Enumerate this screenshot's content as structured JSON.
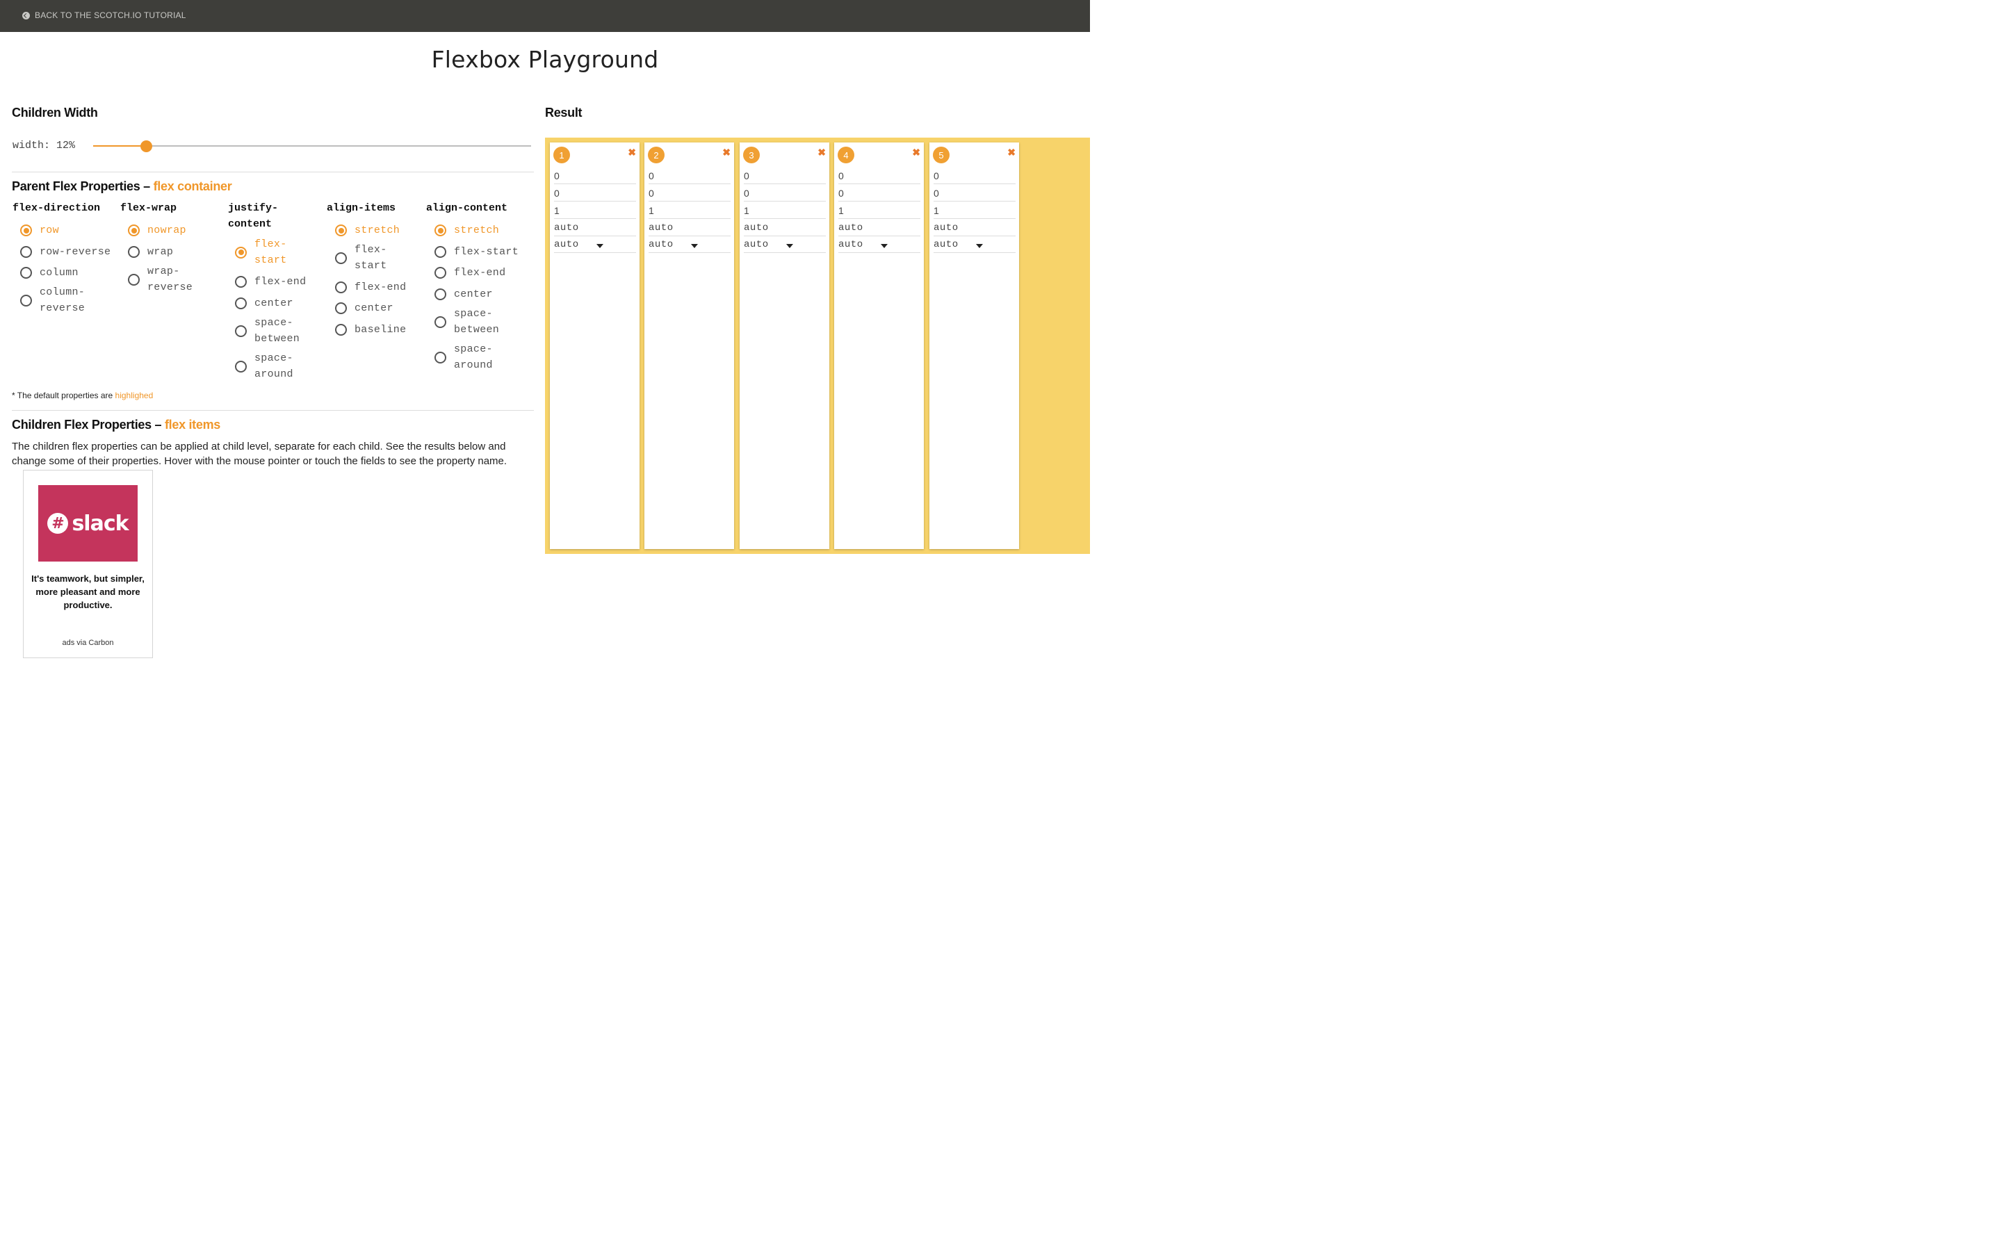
{
  "topbar": {
    "back_label": "BACK TO THE SCOTCH.IO TUTORIAL",
    "icon": "arrow-circle-left-icon"
  },
  "page_title": "Flexbox Playground",
  "children_width": {
    "heading": "Children Width",
    "label": "width: 12%",
    "value_percent": 12
  },
  "parent": {
    "heading": "Parent Flex Properties – ",
    "heading_accent": "flex container",
    "groups": [
      {
        "name": "flex-direction",
        "options": [
          "row",
          "row-reverse",
          "column",
          "column-reverse"
        ],
        "selected": "row"
      },
      {
        "name": "flex-wrap",
        "options": [
          "nowrap",
          "wrap",
          "wrap-reverse"
        ],
        "selected": "nowrap"
      },
      {
        "name": "justify-content",
        "options": [
          "flex-start",
          "flex-end",
          "center",
          "space-between",
          "space-around"
        ],
        "selected": "flex-start"
      },
      {
        "name": "align-items",
        "options": [
          "stretch",
          "flex-start",
          "flex-end",
          "center",
          "baseline"
        ],
        "selected": "stretch"
      },
      {
        "name": "align-content",
        "options": [
          "stretch",
          "flex-start",
          "flex-end",
          "center",
          "space-between",
          "space-around"
        ],
        "selected": "stretch"
      }
    ]
  },
  "note": {
    "text": "* The default properties are ",
    "accent": "highlighed"
  },
  "children": {
    "heading": "Children Flex Properties – ",
    "heading_accent": "flex items",
    "description": "The children flex properties can be applied at child level, separate for each child. See the results below and change some of their properties. Hover with the mouse pointer or touch the fields to see the property name."
  },
  "ad": {
    "logo_mark": "#",
    "logo_word": "slack",
    "text": "It's teamwork, but simpler, more pleasant and more productive.",
    "via": "ads via Carbon"
  },
  "result": {
    "heading": "Result",
    "background_color": "#f7d36a",
    "items": [
      {
        "number": "1",
        "order": "0",
        "grow": "0",
        "shrink": "1",
        "basis": "auto",
        "align_self": "auto"
      },
      {
        "number": "2",
        "order": "0",
        "grow": "0",
        "shrink": "1",
        "basis": "auto",
        "align_self": "auto"
      },
      {
        "number": "3",
        "order": "0",
        "grow": "0",
        "shrink": "1",
        "basis": "auto",
        "align_self": "auto"
      },
      {
        "number": "4",
        "order": "0",
        "grow": "0",
        "shrink": "1",
        "basis": "auto",
        "align_self": "auto"
      },
      {
        "number": "5",
        "order": "0",
        "grow": "0",
        "shrink": "1",
        "basis": "auto",
        "align_self": "auto"
      }
    ]
  },
  "colors": {
    "accent": "#f0972a",
    "topbar": "#3e3e3a",
    "badge": "#f0a033",
    "close": "#e8792a"
  }
}
